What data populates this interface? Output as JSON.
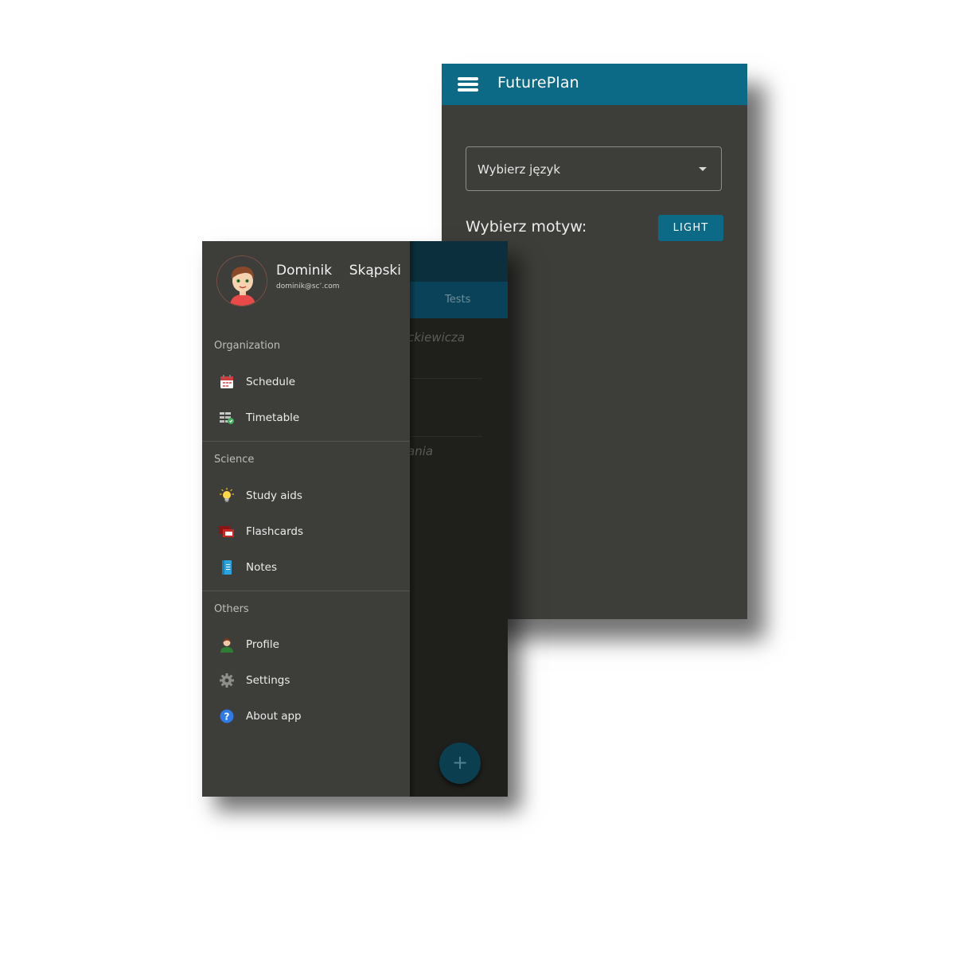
{
  "back_screen": {
    "app_title": "FuturePlan",
    "language_select": {
      "label": "Wybierz język"
    },
    "theme": {
      "label": "Wybierz motyw:",
      "button_label": "LIGHT"
    },
    "colors": {
      "appbar": "#0d6a86",
      "background": "#3d3d39"
    }
  },
  "front_screen": {
    "background_content": {
      "tab_label": "Tests",
      "text_1": "ckiewicza",
      "text_2": "ania",
      "fab_label": "+"
    },
    "drawer": {
      "user": {
        "name": "Dominik    Skąpski",
        "email": "dominik@sc’.com"
      },
      "sections": [
        {
          "title": "Organization",
          "items": [
            {
              "label": "Schedule",
              "icon": "calendar-icon"
            },
            {
              "label": "Timetable",
              "icon": "timetable-icon"
            }
          ]
        },
        {
          "title": "Science",
          "items": [
            {
              "label": "Study aids",
              "icon": "lightbulb-icon"
            },
            {
              "label": "Flashcards",
              "icon": "flashcards-icon"
            },
            {
              "label": "Notes",
              "icon": "notebook-icon"
            }
          ]
        },
        {
          "title": "Others",
          "items": [
            {
              "label": "Profile",
              "icon": "profile-icon"
            },
            {
              "label": "Settings",
              "icon": "gear-icon"
            },
            {
              "label": "About app",
              "icon": "help-icon"
            }
          ]
        }
      ]
    }
  }
}
